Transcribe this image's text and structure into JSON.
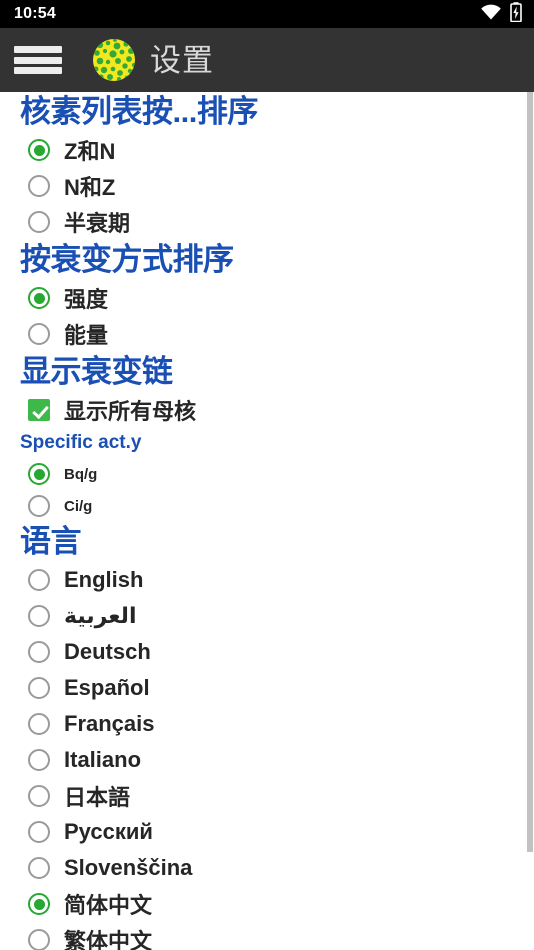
{
  "status_bar": {
    "clock": "10:54",
    "icons": [
      "wifi-icon",
      "battery-charging-icon"
    ],
    "background_color": "#000000",
    "foreground_color": "#ffffff"
  },
  "app_bar": {
    "menu_icon": "hamburger-menu-icon",
    "logo_icon": "nuclide-app-logo",
    "title": "设置",
    "background_color": "#333333",
    "title_color": "#d8d8d8"
  },
  "theme": {
    "section_header_color": "#1a4fb4",
    "accent_checked_color": "#27a832",
    "checkbox_checked_color": "#3fb84a",
    "control_border_color": "#9a9a9a",
    "label_color": "#262626",
    "scrollbar_color": "#c2c2c2"
  },
  "sections": [
    {
      "id": "nuclide-list-sort",
      "title": "核素列表按...排序",
      "title_size": "big",
      "control": "radio",
      "label_size": "lg",
      "row_height": "tall",
      "options": [
        {
          "label": "Z和N",
          "checked": true
        },
        {
          "label": "N和Z",
          "checked": false
        },
        {
          "label": "半衰期",
          "checked": false
        }
      ]
    },
    {
      "id": "decay-mode-sort",
      "title": "按衰变方式排序",
      "title_size": "big",
      "control": "radio",
      "label_size": "lg",
      "row_height": "tall",
      "options": [
        {
          "label": "强度",
          "checked": true
        },
        {
          "label": "能量",
          "checked": false
        }
      ]
    },
    {
      "id": "show-decay-chain",
      "title": "显示衰变链",
      "title_size": "big",
      "control": "checkbox",
      "label_size": "lg",
      "row_height": "tall",
      "options": [
        {
          "label": "显示所有母核",
          "checked": true
        }
      ]
    },
    {
      "id": "specific-activity",
      "title": "Specific act.y",
      "title_size": "small",
      "control": "radio",
      "label_size": "sm",
      "row_height": "short",
      "options": [
        {
          "label": "Bq/g",
          "checked": true
        },
        {
          "label": "Ci/g",
          "checked": false
        }
      ]
    },
    {
      "id": "language",
      "title": "语言",
      "title_size": "big",
      "control": "radio",
      "label_size": "lg",
      "row_height": "tall",
      "options": [
        {
          "label": "English",
          "checked": false
        },
        {
          "label": "العربية",
          "checked": false
        },
        {
          "label": "Deutsch",
          "checked": false
        },
        {
          "label": "Español",
          "checked": false
        },
        {
          "label": "Français",
          "checked": false
        },
        {
          "label": "Italiano",
          "checked": false
        },
        {
          "label": "日本語",
          "checked": false
        },
        {
          "label": "Русский",
          "checked": false
        },
        {
          "label": "Slovenščina",
          "checked": false
        },
        {
          "label": "简体中文",
          "checked": true
        },
        {
          "label": "繁体中文",
          "checked": false
        }
      ]
    }
  ]
}
